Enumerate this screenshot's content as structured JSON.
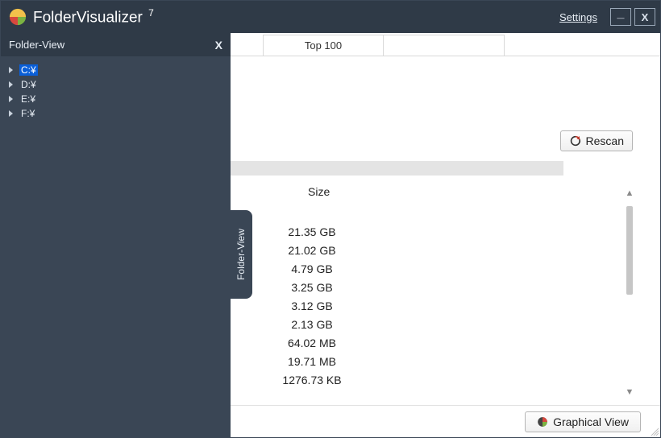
{
  "titlebar": {
    "app_name": "FolderVisualizer",
    "version_sup": "7",
    "settings_label": "Settings",
    "minimize_label": "_",
    "close_label": "X"
  },
  "sidebar": {
    "header_label": "Folder-View",
    "close_label": "X",
    "items": [
      {
        "label": "C:¥",
        "selected": true
      },
      {
        "label": "D:¥",
        "selected": false
      },
      {
        "label": "E:¥",
        "selected": false
      },
      {
        "label": "F:¥",
        "selected": false
      }
    ]
  },
  "side_tab": {
    "label": "Folder-View"
  },
  "tabs": {
    "items": [
      {
        "label": "Top 100"
      }
    ]
  },
  "toolbar": {
    "rescan_label": "Rescan"
  },
  "list": {
    "columns": {
      "size": "Size"
    },
    "rows": [
      {
        "size": "21.35 GB"
      },
      {
        "size": "21.02 GB"
      },
      {
        "size": "4.79 GB"
      },
      {
        "size": "3.25 GB"
      },
      {
        "size": "3.12 GB"
      },
      {
        "size": "2.13 GB"
      },
      {
        "size": "64.02 MB"
      },
      {
        "size": "19.71 MB"
      },
      {
        "size": "1276.73 KB"
      }
    ]
  },
  "footer": {
    "graphical_view_label": "Graphical View"
  },
  "colors": {
    "bg_dark": "#2f3a47",
    "bg_dark2": "#3a4655",
    "accent_select": "#0a5fd8"
  }
}
